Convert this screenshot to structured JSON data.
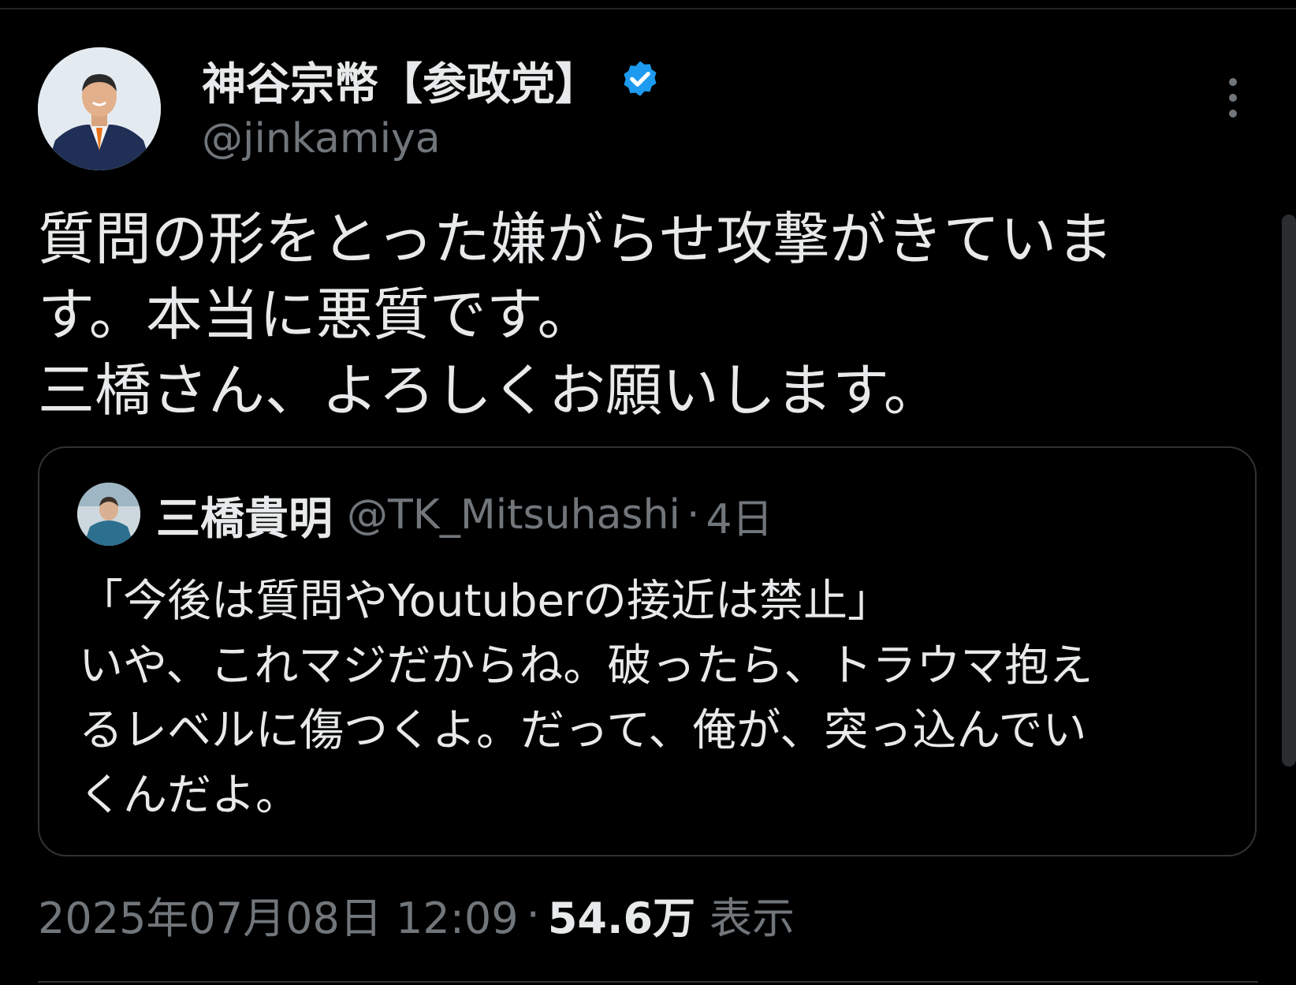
{
  "tweet": {
    "author": {
      "display_name": "神谷宗幣【参政党】",
      "handle": "@jinkamiya",
      "verified": true,
      "verified_color": "#1d9bf0"
    },
    "more_icon": "more-vertical-icon",
    "text_lines": [
      "質問の形をとった嫌がらせ攻撃がきていま",
      "す。本当に悪質です。",
      "三橋さん、よろしくお願いします。"
    ],
    "quote": {
      "display_name": "三橋貴明",
      "handle": "@TK_Mitsuhashi",
      "separator": "·",
      "time": "4日",
      "text_lines": [
        "「今後は質問やYoutuberの接近は禁止」",
        "いや、これマジだからね。破ったら、トラウマ抱え",
        "るレベルに傷つくよ。だって、俺が、突っ込んでい",
        "くんだよ。"
      ]
    },
    "meta": {
      "datetime": "2025年07月08日 12:09",
      "separator": "·",
      "views": "54.6万",
      "views_label": "表示"
    }
  }
}
